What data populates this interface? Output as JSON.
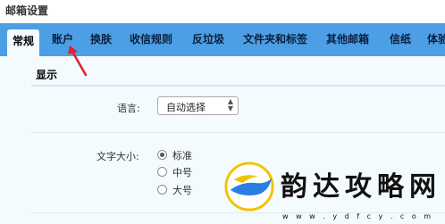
{
  "window": {
    "title": "邮箱设置"
  },
  "tabs": [
    {
      "label": "常规",
      "active": true
    },
    {
      "label": "账户",
      "active": false
    },
    {
      "label": "换肤",
      "active": false
    },
    {
      "label": "收信规则",
      "active": false
    },
    {
      "label": "反垃圾",
      "active": false
    },
    {
      "label": "文件夹和标签",
      "active": false
    },
    {
      "label": "其他邮箱",
      "active": false
    },
    {
      "label": "信纸",
      "active": false
    },
    {
      "label": "体验",
      "active": false
    }
  ],
  "display_section": {
    "heading": "显示",
    "language": {
      "label": "语言:",
      "selected": "自动选择"
    },
    "font_size": {
      "label": "文字大小:",
      "options": [
        {
          "label": "标准",
          "checked": true
        },
        {
          "label": "中号",
          "checked": false
        },
        {
          "label": "大号",
          "checked": false
        }
      ]
    }
  },
  "watermark": {
    "title": "韵达攻略网",
    "url": "w w w . y d f c y . c o m"
  },
  "colors": {
    "tab_bar": "#4c9fe4",
    "content_bg": "#f4fbff",
    "arrow": "#e0202a"
  },
  "icons": {
    "pointer_arrow": "red-arrow-icon",
    "select_caret": "updown-caret-icon",
    "logo": "yunda-logo-icon"
  }
}
